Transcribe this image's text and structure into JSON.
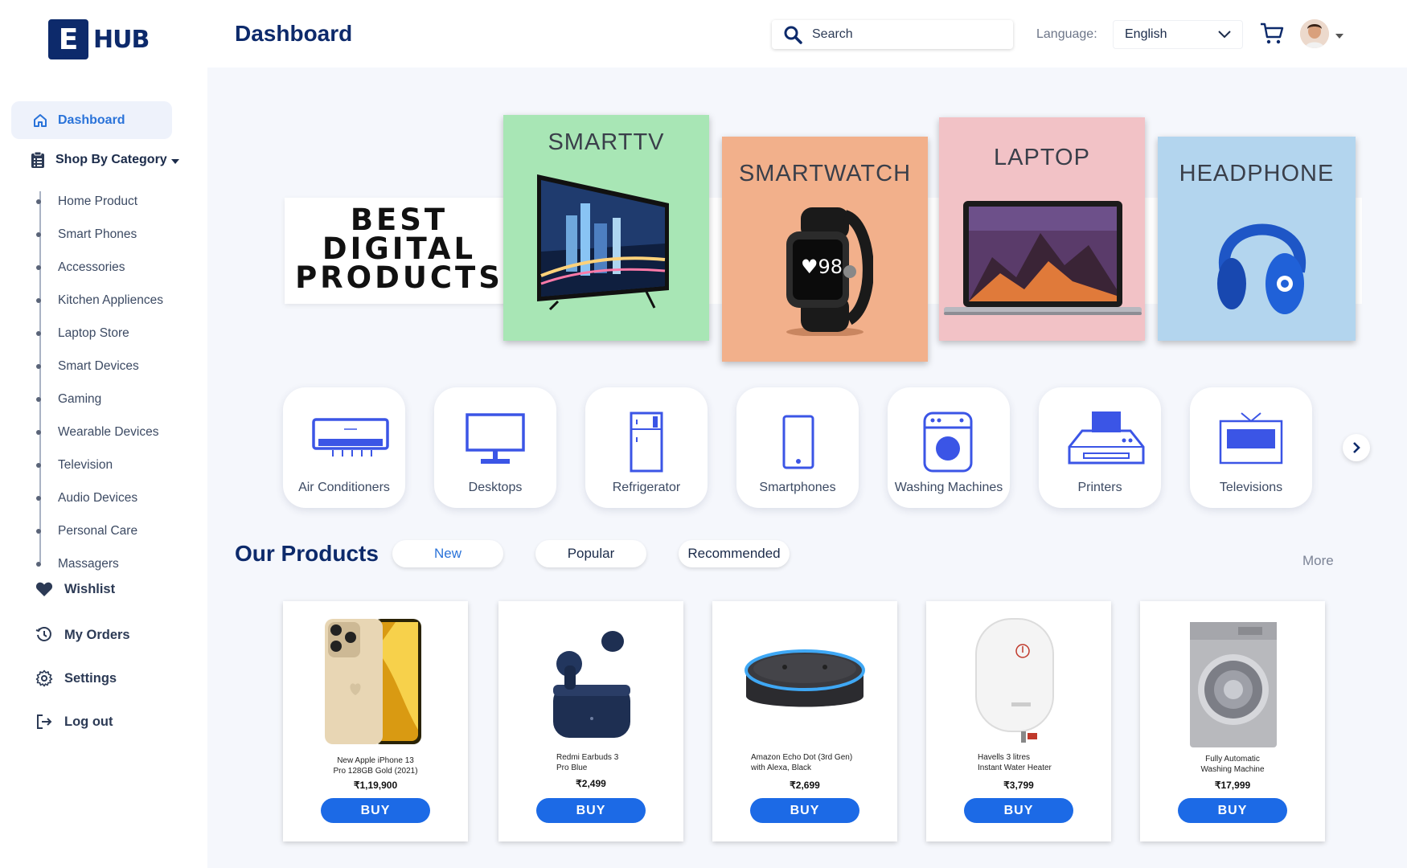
{
  "brand": {
    "logo_letter": "E",
    "logo_text": "HUB"
  },
  "header": {
    "title": "Dashboard",
    "search_placeholder": "Search",
    "language_label": "Language:",
    "language_value": "English"
  },
  "sidebar": {
    "dashboard": "Dashboard",
    "shop_by_category": "Shop By Category",
    "categories": [
      "Home Product",
      "Smart Phones",
      "Accessories",
      "Kitchen Appliences",
      "Laptop Store",
      "Smart Devices",
      "Gaming",
      "Wearable Devices",
      "Television",
      "Audio Devices",
      "Personal Care",
      "Massagers"
    ],
    "wishlist": "Wishlist",
    "my_orders": "My Orders",
    "settings": "Settings",
    "logout": "Log out"
  },
  "banner": {
    "headline_line1": "BEST",
    "headline_line2": "DIGITAL",
    "headline_line3": "PRODUCTS",
    "cards": [
      {
        "title": "SMARTTV",
        "bg": "#a8e6b5"
      },
      {
        "title": "SMARTWATCH",
        "bg": "#f2b08b"
      },
      {
        "title": "LAPTOP",
        "bg": "#f2c2c6"
      },
      {
        "title": "HEADPHONE",
        "bg": "#b3d5ee"
      }
    ]
  },
  "categories": [
    "Air Conditioners",
    "Desktops",
    "Refrigerator",
    "Smartphones",
    "Washing Machines",
    "Printers",
    "Televisions"
  ],
  "products_section": {
    "title": "Our Products",
    "tabs": [
      "New",
      "Popular",
      "Recommended"
    ],
    "active_tab": "New",
    "more": "More"
  },
  "products": [
    {
      "name_line1": "New Apple iPhone 13",
      "name_line2": "Pro 128GB Gold (2021)",
      "price": "₹1,19,900",
      "buy": "BUY"
    },
    {
      "name_line1": "Redmi Earbuds 3",
      "name_line2": "Pro Blue",
      "price": "₹2,499",
      "buy": "BUY"
    },
    {
      "name_line1": "Amazon Echo Dot (3rd Gen)",
      "name_line2": "with Alexa, Black",
      "price": "₹2,699",
      "buy": "BUY"
    },
    {
      "name_line1": "Havells 3 litres",
      "name_line2": "Instant Water Heater",
      "price": "₹3,799",
      "buy": "BUY"
    },
    {
      "name_line1": "Fully Automatic",
      "name_line2": "Washing Machine",
      "price": "₹17,999",
      "buy": "BUY"
    }
  ],
  "colors": {
    "accent": "#2a73d9",
    "brand": "#0d2a6b",
    "buy": "#1c6ae6",
    "icon": "#3b55e6"
  }
}
